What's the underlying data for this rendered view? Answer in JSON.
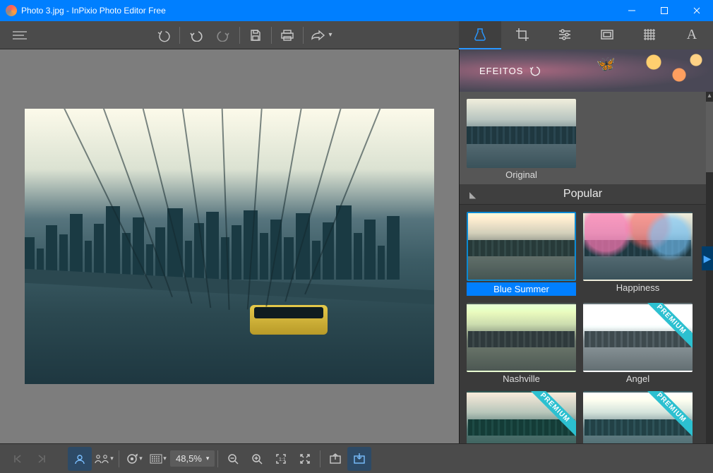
{
  "window": {
    "title": "Photo 3.jpg - InPixio Photo Editor Free"
  },
  "topbar": {
    "menu": "Menu",
    "undo_full": "UndoFull",
    "undo": "Undo",
    "redo": "Redo",
    "save": "Save",
    "print": "Print",
    "share": "Share"
  },
  "modeTabs": [
    {
      "name": "effects",
      "active": true
    },
    {
      "name": "crop",
      "active": false
    },
    {
      "name": "adjust",
      "active": false
    },
    {
      "name": "frame",
      "active": false
    },
    {
      "name": "texture",
      "active": false
    },
    {
      "name": "text",
      "active": false
    }
  ],
  "effects": {
    "header": "EFEITOS",
    "original_label": "Original",
    "group_title": "Popular",
    "premium_label": "PREMIUM",
    "groups": [
      {
        "title": "Popular",
        "items": [
          {
            "label": "Blue Summer",
            "variant": "blue-summer",
            "selected": true,
            "premium": false
          },
          {
            "label": "Happiness",
            "variant": "happiness",
            "selected": false,
            "premium": false
          },
          {
            "label": "Nashville",
            "variant": "nashville",
            "selected": false,
            "premium": false
          },
          {
            "label": "Angel",
            "variant": "angel",
            "selected": false,
            "premium": true
          },
          {
            "label": "",
            "variant": "blue-summer",
            "selected": false,
            "premium": true
          },
          {
            "label": "",
            "variant": "nashville",
            "selected": false,
            "premium": true
          }
        ]
      }
    ]
  },
  "bottombar": {
    "prev": "Previous",
    "next": "Next",
    "mode_single": "Single",
    "mode_compare": "Compare",
    "rotate": "Rotate",
    "grid": "Grid",
    "zoom_value": "48,5%",
    "zoom_out": "ZoomOut",
    "zoom_in": "ZoomIn",
    "fit": "Fit",
    "fill": "Fill",
    "export": "Export",
    "import": "Import"
  }
}
